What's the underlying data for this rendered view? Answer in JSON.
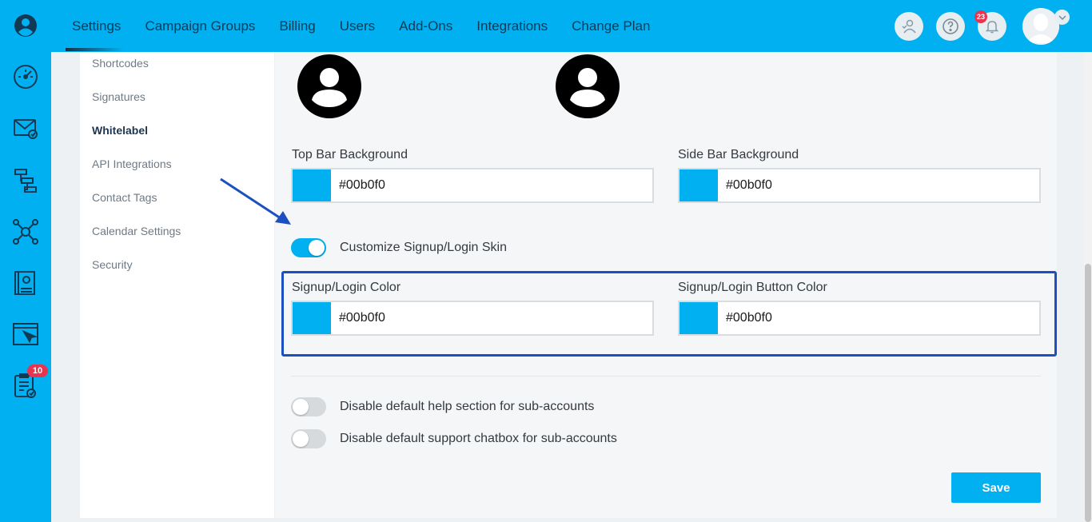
{
  "rail": {
    "badge": "10"
  },
  "topnav": {
    "items": [
      "Settings",
      "Campaign Groups",
      "Billing",
      "Users",
      "Add-Ons",
      "Integrations",
      "Change Plan"
    ],
    "notification_count": "23"
  },
  "subnav": {
    "items": [
      "Shortcodes",
      "Signatures",
      "Whitelabel",
      "API Integrations",
      "Contact Tags",
      "Calendar Settings",
      "Security"
    ],
    "active": "Whitelabel"
  },
  "form": {
    "top_bar_label": "Top Bar Background",
    "top_bar_value": "#00b0f0",
    "side_bar_label": "Side Bar Background",
    "side_bar_value": "#00b0f0",
    "customize_toggle_label": "Customize Signup/Login Skin",
    "customize_toggle_on": true,
    "login_color_label": "Signup/Login Color",
    "login_color_value": "#00b0f0",
    "login_button_color_label": "Signup/Login Button Color",
    "login_button_color_value": "#00b0f0",
    "disable_help_label": "Disable default help section for sub-accounts",
    "disable_help_on": false,
    "disable_chat_label": "Disable default support chatbox for sub-accounts",
    "disable_chat_on": false,
    "save_label": "Save"
  },
  "colors": {
    "brand": "#00b0f0",
    "highlight": "#1c4fbf",
    "badge": "#e8344e"
  }
}
